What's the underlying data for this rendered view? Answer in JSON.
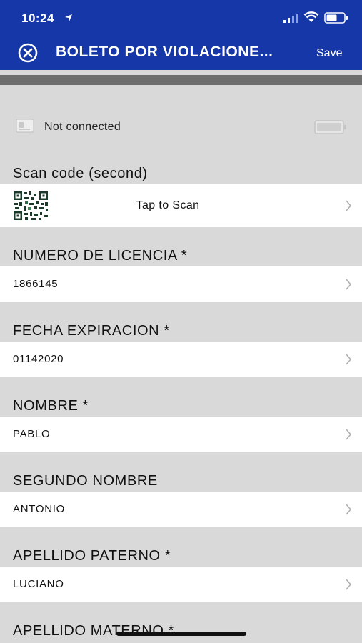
{
  "status_bar": {
    "time": "10:24"
  },
  "nav": {
    "title": "BOLETO POR VIOLACIONE...",
    "save_label": "Save"
  },
  "connection": {
    "status": "Not connected"
  },
  "scan": {
    "label": "Scan code (second)",
    "action": "Tap to Scan"
  },
  "fields": [
    {
      "label": "NUMERO DE LICENCIA *",
      "value": "1866145"
    },
    {
      "label": "FECHA EXPIRACION *",
      "value": "01142020"
    },
    {
      "label": "NOMBRE *",
      "value": "PABLO"
    },
    {
      "label": "SEGUNDO NOMBRE",
      "value": "ANTONIO"
    },
    {
      "label": "APELLIDO PATERNO *",
      "value": "LUCIANO"
    },
    {
      "label": "APELLIDO MATERNO *",
      "value": ""
    }
  ]
}
